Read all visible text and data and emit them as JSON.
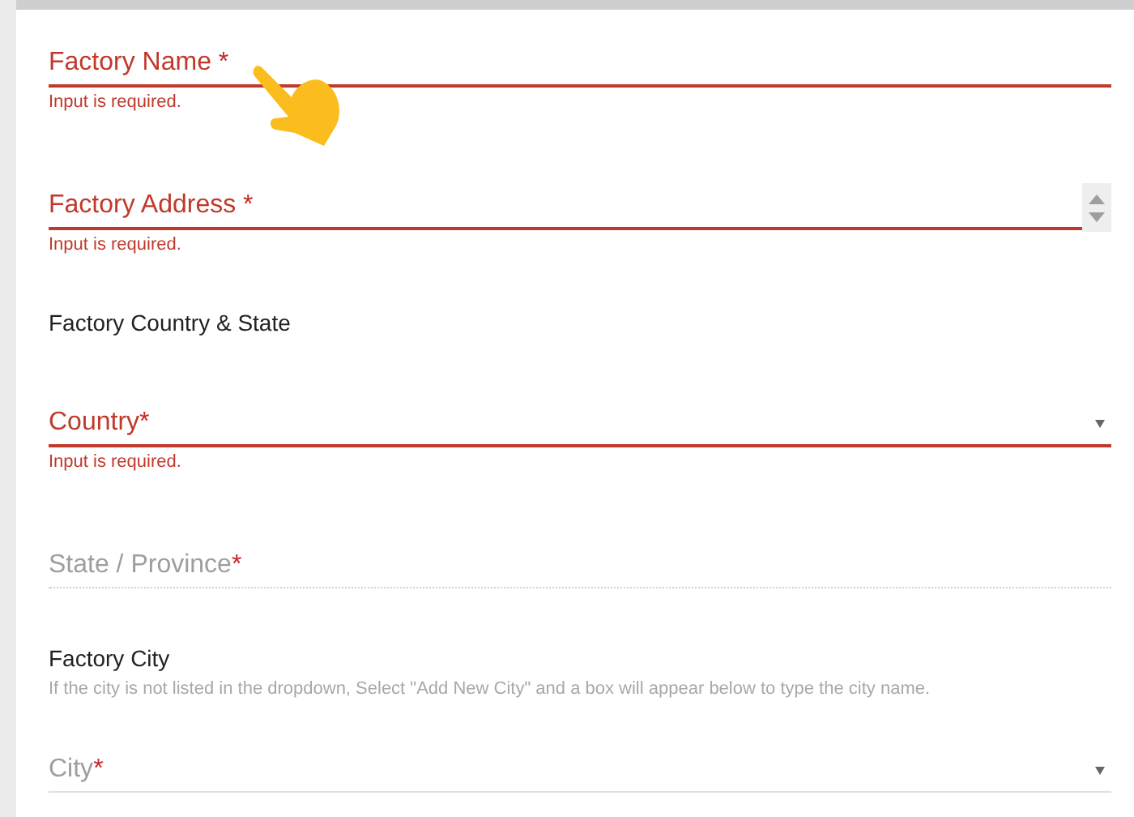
{
  "fields": [
    {
      "kind": "text",
      "label": "Factory Name",
      "required_mark": " *",
      "invalid": true,
      "disabled": false,
      "error": "Input is required."
    },
    {
      "kind": "textarea",
      "label": "Factory Address",
      "required_mark": " *",
      "invalid": true,
      "disabled": false,
      "error": "Input is required."
    },
    {
      "kind": "heading",
      "text": "Factory Country & State"
    },
    {
      "kind": "select",
      "label": "Country",
      "required_mark": "*",
      "invalid": true,
      "disabled": false,
      "error": "Input is required."
    },
    {
      "kind": "select",
      "label": "State / Province",
      "required_mark": "*",
      "invalid": false,
      "disabled": true
    },
    {
      "kind": "heading",
      "text": "Factory City",
      "hint": "If the city is not listed in the dropdown, Select \"Add New City\" and a box will appear below to type the city name."
    },
    {
      "kind": "select",
      "label": "City",
      "required_mark": "*",
      "invalid": false,
      "disabled": false
    }
  ]
}
